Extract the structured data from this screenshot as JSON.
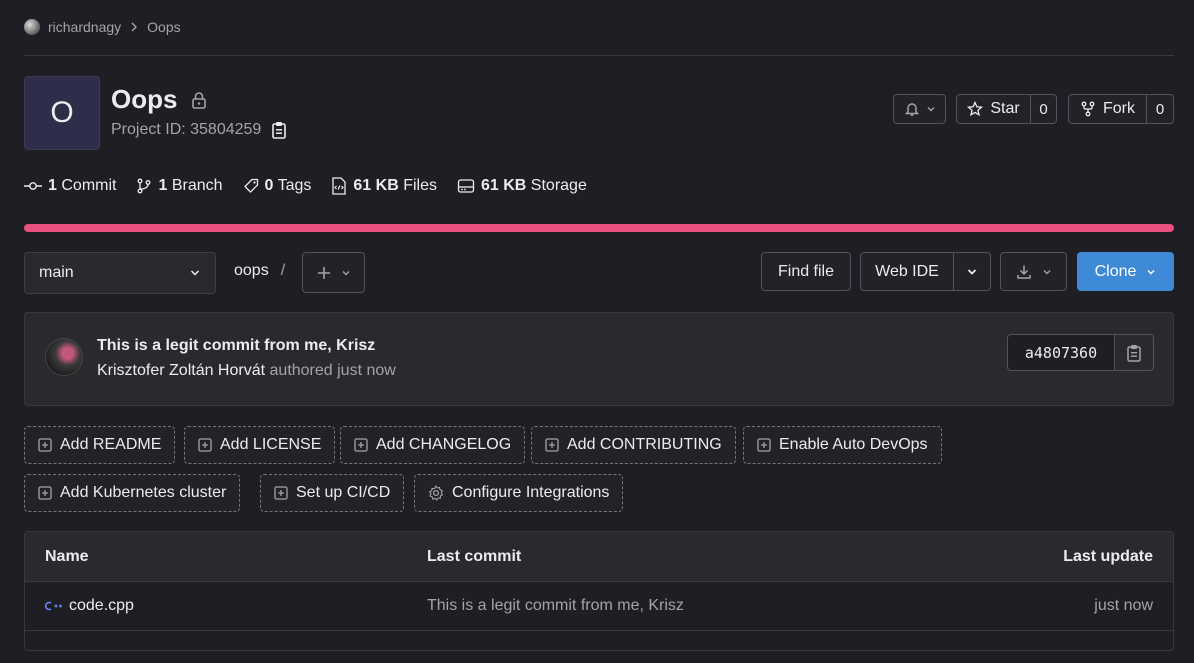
{
  "breadcrumb": {
    "user": "richardnagy",
    "project": "Oops"
  },
  "project": {
    "avatar_letter": "O",
    "title": "Oops",
    "project_id": "Project ID: 35804259"
  },
  "actions": {
    "star_label": "Star",
    "star_count": "0",
    "fork_label": "Fork",
    "fork_count": "0"
  },
  "stats": {
    "commits_count": "1",
    "commits_label": "Commit",
    "branches_count": "1",
    "branches_label": "Branch",
    "tags_count": "0",
    "tags_label": "Tags",
    "files_size": "61 KB",
    "files_label": "Files",
    "storage_size": "61 KB",
    "storage_label": "Storage"
  },
  "colors": {
    "language_bar": "#e8517f",
    "clone_button": "#1f78d1",
    "cpp_icon": "#6b8cff"
  },
  "tree": {
    "branch": "main",
    "path": "oops",
    "path_sep": "/",
    "find_file": "Find file",
    "web_ide": "Web IDE",
    "clone": "Clone"
  },
  "commit": {
    "title": "This is a legit commit from me, Krisz",
    "author": "Krisztofer Zoltán Horvát",
    "meta": "authored just now",
    "sha": "a4807360"
  },
  "quick_actions": [
    "Add README",
    "Add LICENSE",
    "Add CHANGELOG",
    "Add CONTRIBUTING",
    "Enable Auto DevOps",
    "Add Kubernetes cluster",
    "Set up CI/CD",
    "Configure Integrations"
  ],
  "files_table": {
    "headers": {
      "name": "Name",
      "last_commit": "Last commit",
      "last_update": "Last update"
    },
    "rows": [
      {
        "name": "code.cpp",
        "last_commit": "This is a legit commit from me, Krisz",
        "last_update": "just now"
      }
    ]
  }
}
